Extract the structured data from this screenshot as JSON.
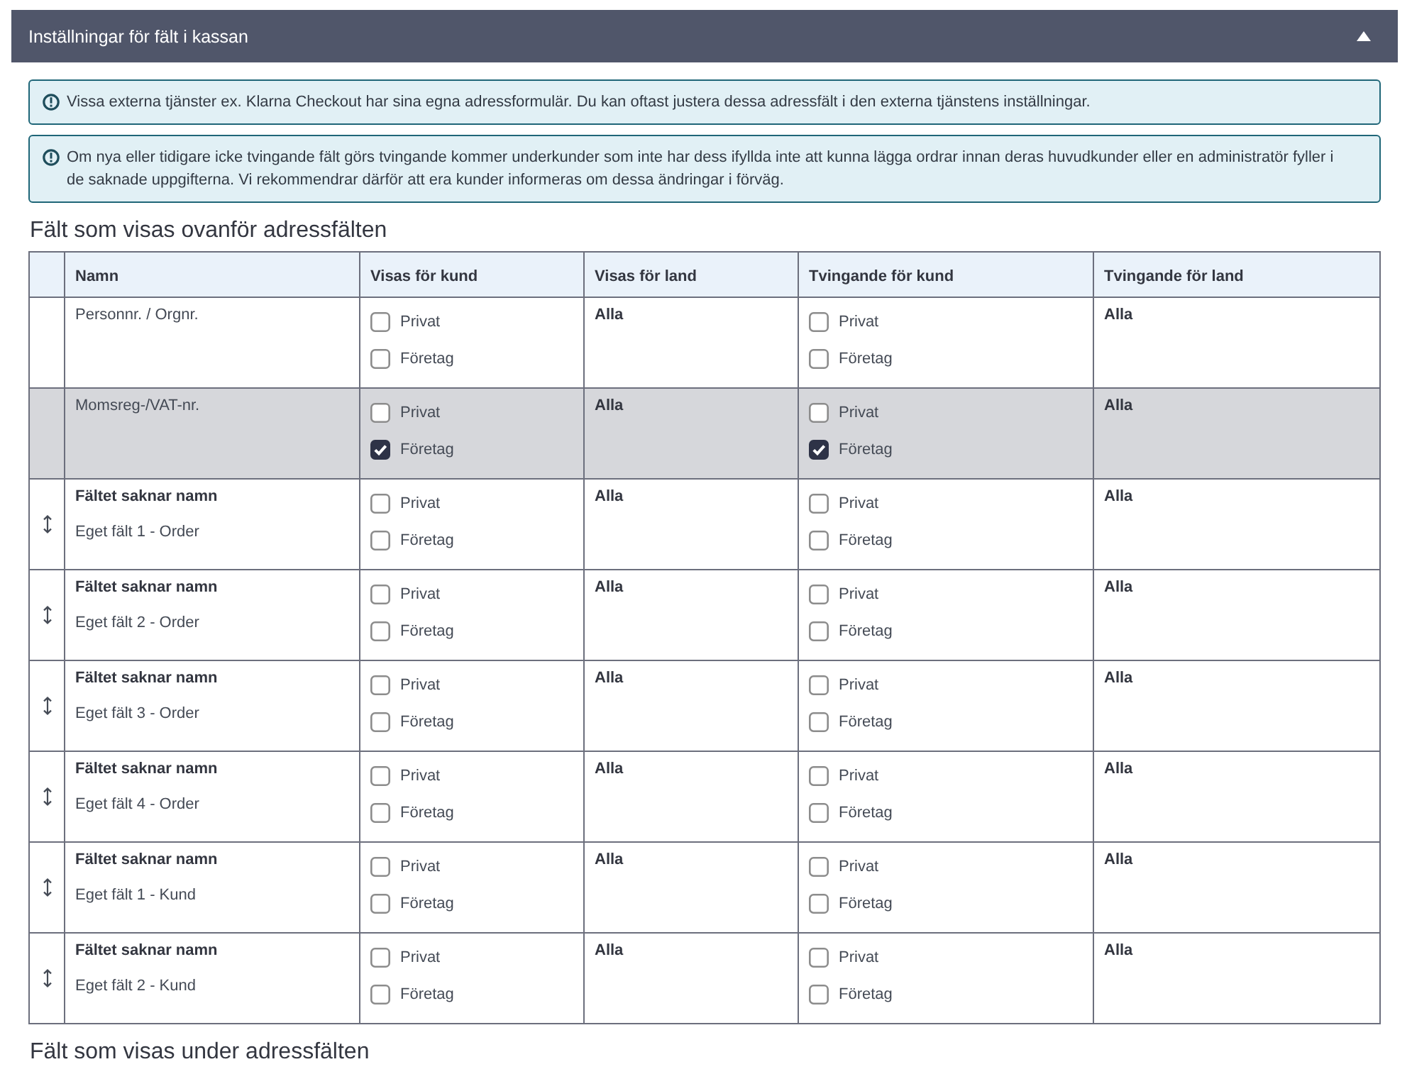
{
  "panel": {
    "title": "Inställningar för fält i kassan",
    "expanded": true
  },
  "alerts": [
    {
      "text": "Vissa externa tjänster ex. Klarna Checkout har sina egna adressformulär. Du kan oftast justera dessa adressfält i den externa tjänstens inställningar."
    },
    {
      "text": "Om nya eller tidigare icke tvingande fält görs tvingande kommer underkunder som inte har dess ifyllda inte att kunna lägga ordrar innan deras huvudkunder eller en administratör fyller i de saknade uppgifterna. Vi rekommendrar därför att era kunder informeras om dessa ändringar i förväg."
    }
  ],
  "sections": [
    {
      "heading": "Fält som visas ovanför adressfälten",
      "table": {
        "columns": [
          "Namn",
          "Visas för kund",
          "Visas för land",
          "Tvingande för kund",
          "Tvingande för land"
        ],
        "rows": [
          {
            "kind": "standard",
            "highlighted": false,
            "cells": [
              {
                "kind": "name",
                "name": "Personnr. / Orgnr."
              },
              {
                "kind": "checkboxes",
                "options": [
                  {
                    "label": "Privat",
                    "checked": false
                  },
                  {
                    "label": "Företag",
                    "checked": false
                  }
                ]
              },
              {
                "kind": "text",
                "text": "Alla"
              },
              {
                "kind": "checkboxes",
                "options": [
                  {
                    "label": "Privat",
                    "checked": false
                  },
                  {
                    "label": "Företag",
                    "checked": false
                  }
                ]
              },
              {
                "kind": "text",
                "text": "Alla"
              }
            ]
          },
          {
            "kind": "standard",
            "highlighted": true,
            "cells": [
              {
                "kind": "name",
                "name": "Momsreg-/VAT-nr."
              },
              {
                "kind": "checkboxes",
                "options": [
                  {
                    "label": "Privat",
                    "checked": false
                  },
                  {
                    "label": "Företag",
                    "checked": true
                  }
                ]
              },
              {
                "kind": "text",
                "text": "Alla"
              },
              {
                "kind": "checkboxes",
                "options": [
                  {
                    "label": "Privat",
                    "checked": false
                  },
                  {
                    "label": "Företag",
                    "checked": true
                  }
                ]
              },
              {
                "kind": "text",
                "text": "Alla"
              }
            ]
          },
          {
            "kind": "custom",
            "highlighted": false,
            "cells": [
              {
                "kind": "name",
                "title": "Fältet saknar namn",
                "name": "Eget fält 1 - Order"
              },
              {
                "kind": "checkboxes",
                "options": [
                  {
                    "label": "Privat",
                    "checked": false
                  },
                  {
                    "label": "Företag",
                    "checked": false
                  }
                ]
              },
              {
                "kind": "text",
                "text": "Alla"
              },
              {
                "kind": "checkboxes",
                "options": [
                  {
                    "label": "Privat",
                    "checked": false
                  },
                  {
                    "label": "Företag",
                    "checked": false
                  }
                ]
              },
              {
                "kind": "text",
                "text": "Alla"
              }
            ]
          },
          {
            "kind": "custom",
            "highlighted": false,
            "cells": [
              {
                "kind": "name",
                "title": "Fältet saknar namn",
                "name": "Eget fält 2 - Order"
              },
              {
                "kind": "checkboxes",
                "options": [
                  {
                    "label": "Privat",
                    "checked": false
                  },
                  {
                    "label": "Företag",
                    "checked": false
                  }
                ]
              },
              {
                "kind": "text",
                "text": "Alla"
              },
              {
                "kind": "checkboxes",
                "options": [
                  {
                    "label": "Privat",
                    "checked": false
                  },
                  {
                    "label": "Företag",
                    "checked": false
                  }
                ]
              },
              {
                "kind": "text",
                "text": "Alla"
              }
            ]
          },
          {
            "kind": "custom",
            "highlighted": false,
            "cells": [
              {
                "kind": "name",
                "title": "Fältet saknar namn",
                "name": "Eget fält 3 - Order"
              },
              {
                "kind": "checkboxes",
                "options": [
                  {
                    "label": "Privat",
                    "checked": false
                  },
                  {
                    "label": "Företag",
                    "checked": false
                  }
                ]
              },
              {
                "kind": "text",
                "text": "Alla"
              },
              {
                "kind": "checkboxes",
                "options": [
                  {
                    "label": "Privat",
                    "checked": false
                  },
                  {
                    "label": "Företag",
                    "checked": false
                  }
                ]
              },
              {
                "kind": "text",
                "text": "Alla"
              }
            ]
          },
          {
            "kind": "custom",
            "highlighted": false,
            "cells": [
              {
                "kind": "name",
                "title": "Fältet saknar namn",
                "name": "Eget fält 4 - Order"
              },
              {
                "kind": "checkboxes",
                "options": [
                  {
                    "label": "Privat",
                    "checked": false
                  },
                  {
                    "label": "Företag",
                    "checked": false
                  }
                ]
              },
              {
                "kind": "text",
                "text": "Alla"
              },
              {
                "kind": "checkboxes",
                "options": [
                  {
                    "label": "Privat",
                    "checked": false
                  },
                  {
                    "label": "Företag",
                    "checked": false
                  }
                ]
              },
              {
                "kind": "text",
                "text": "Alla"
              }
            ]
          },
          {
            "kind": "custom",
            "highlighted": false,
            "cells": [
              {
                "kind": "name",
                "title": "Fältet saknar namn",
                "name": "Eget fält 1 - Kund"
              },
              {
                "kind": "checkboxes",
                "options": [
                  {
                    "label": "Privat",
                    "checked": false
                  },
                  {
                    "label": "Företag",
                    "checked": false
                  }
                ]
              },
              {
                "kind": "text",
                "text": "Alla"
              },
              {
                "kind": "checkboxes",
                "options": [
                  {
                    "label": "Privat",
                    "checked": false
                  },
                  {
                    "label": "Företag",
                    "checked": false
                  }
                ]
              },
              {
                "kind": "text",
                "text": "Alla"
              }
            ]
          },
          {
            "kind": "custom",
            "highlighted": false,
            "cells": [
              {
                "kind": "name",
                "title": "Fältet saknar namn",
                "name": "Eget fält 2 - Kund"
              },
              {
                "kind": "checkboxes",
                "options": [
                  {
                    "label": "Privat",
                    "checked": false
                  },
                  {
                    "label": "Företag",
                    "checked": false
                  }
                ]
              },
              {
                "kind": "text",
                "text": "Alla"
              },
              {
                "kind": "checkboxes",
                "options": [
                  {
                    "label": "Privat",
                    "checked": false
                  },
                  {
                    "label": "Företag",
                    "checked": false
                  }
                ]
              },
              {
                "kind": "text",
                "text": "Alla"
              }
            ]
          }
        ]
      }
    },
    {
      "heading": "Fält som visas under adressfälten"
    }
  ]
}
